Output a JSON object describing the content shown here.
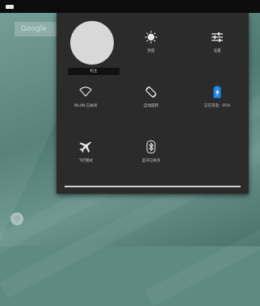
{
  "search": {
    "hint": "Google"
  },
  "user": {
    "name": "机主"
  },
  "tiles": {
    "brightness": {
      "label": "亮度"
    },
    "settings": {
      "label": "设置"
    },
    "wifi": {
      "label": "WLAN 已关闭"
    },
    "rotation": {
      "label": "自动旋转"
    },
    "battery": {
      "label": "正在充电：95%",
      "level": 0.95
    },
    "airplane": {
      "label": "飞行模式"
    },
    "bluetooth": {
      "label": "蓝牙已关闭"
    }
  },
  "slider": {
    "value": 1.0
  },
  "colors": {
    "panel": "#2b2b2b",
    "battery_accent": "#1e88e5",
    "icon": "#e8e8e8"
  }
}
